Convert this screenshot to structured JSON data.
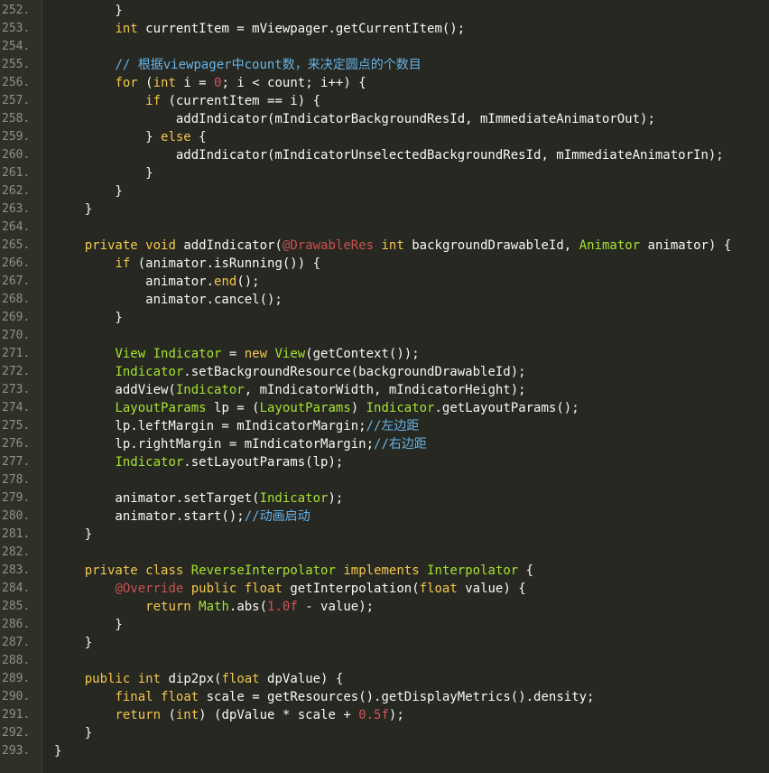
{
  "colors": {
    "background": "#272822",
    "gutter": "#2f3129",
    "plain": "#f8f8f2",
    "keyword": "#f3c74a",
    "type": "#a6e22e",
    "number": "#cf5555",
    "annotation": "#c7524f",
    "comment": "#66b3e6",
    "line_number": "#8f908a"
  },
  "lines": [
    {
      "n": "252.",
      "t": [
        [
          "plain",
          "        }"
        ]
      ]
    },
    {
      "n": "253.",
      "t": [
        [
          "plain",
          "        "
        ],
        [
          "kw",
          "int"
        ],
        [
          "plain",
          " currentItem = mViewpager.getCurrentItem();"
        ]
      ]
    },
    {
      "n": "254.",
      "t": []
    },
    {
      "n": "255.",
      "t": [
        [
          "plain",
          "        "
        ],
        [
          "cm",
          "// 根据viewpager中count数，来决定圆点的个数目"
        ]
      ]
    },
    {
      "n": "256.",
      "t": [
        [
          "plain",
          "        "
        ],
        [
          "kw",
          "for"
        ],
        [
          "plain",
          " ("
        ],
        [
          "kw",
          "int"
        ],
        [
          "plain",
          " i = "
        ],
        [
          "num",
          "0"
        ],
        [
          "plain",
          "; i < count; i++) {"
        ]
      ]
    },
    {
      "n": "257.",
      "t": [
        [
          "plain",
          "            "
        ],
        [
          "kw",
          "if"
        ],
        [
          "plain",
          " (currentItem == i) {"
        ]
      ]
    },
    {
      "n": "258.",
      "t": [
        [
          "plain",
          "                addIndicator(mIndicatorBackgroundResId, mImmediateAnimatorOut);"
        ]
      ]
    },
    {
      "n": "259.",
      "t": [
        [
          "plain",
          "            } "
        ],
        [
          "kw",
          "else"
        ],
        [
          "plain",
          " {"
        ]
      ]
    },
    {
      "n": "260.",
      "t": [
        [
          "plain",
          "                addIndicator(mIndicatorUnselectedBackgroundResId, mImmediateAnimatorIn);"
        ]
      ]
    },
    {
      "n": "261.",
      "t": [
        [
          "plain",
          "            }"
        ]
      ]
    },
    {
      "n": "262.",
      "t": [
        [
          "plain",
          "        }"
        ]
      ]
    },
    {
      "n": "263.",
      "t": [
        [
          "plain",
          "    }"
        ]
      ]
    },
    {
      "n": "264.",
      "t": []
    },
    {
      "n": "265.",
      "t": [
        [
          "plain",
          "    "
        ],
        [
          "kw",
          "private"
        ],
        [
          "plain",
          " "
        ],
        [
          "kw",
          "void"
        ],
        [
          "plain",
          " addIndicator("
        ],
        [
          "ann",
          "@DrawableRes"
        ],
        [
          "plain",
          " "
        ],
        [
          "kw",
          "int"
        ],
        [
          "plain",
          " backgroundDrawableId, "
        ],
        [
          "type",
          "Animator"
        ],
        [
          "plain",
          " animator) {"
        ]
      ]
    },
    {
      "n": "266.",
      "t": [
        [
          "plain",
          "        "
        ],
        [
          "kw",
          "if"
        ],
        [
          "plain",
          " (animator.isRunning()) {"
        ]
      ]
    },
    {
      "n": "267.",
      "t": [
        [
          "plain",
          "            animator."
        ],
        [
          "kw",
          "end"
        ],
        [
          "plain",
          "();"
        ]
      ]
    },
    {
      "n": "268.",
      "t": [
        [
          "plain",
          "            animator.cancel();"
        ]
      ]
    },
    {
      "n": "269.",
      "t": [
        [
          "plain",
          "        }"
        ]
      ]
    },
    {
      "n": "270.",
      "t": []
    },
    {
      "n": "271.",
      "t": [
        [
          "plain",
          "        "
        ],
        [
          "type",
          "View"
        ],
        [
          "plain",
          " "
        ],
        [
          "type",
          "Indicator"
        ],
        [
          "plain",
          " = "
        ],
        [
          "kw",
          "new"
        ],
        [
          "plain",
          " "
        ],
        [
          "type",
          "View"
        ],
        [
          "plain",
          "(getContext());"
        ]
      ]
    },
    {
      "n": "272.",
      "t": [
        [
          "plain",
          "        "
        ],
        [
          "type",
          "Indicator"
        ],
        [
          "plain",
          ".setBackgroundResource(backgroundDrawableId);"
        ]
      ]
    },
    {
      "n": "273.",
      "t": [
        [
          "plain",
          "        addView("
        ],
        [
          "type",
          "Indicator"
        ],
        [
          "plain",
          ", mIndicatorWidth, mIndicatorHeight);"
        ]
      ]
    },
    {
      "n": "274.",
      "t": [
        [
          "plain",
          "        "
        ],
        [
          "type",
          "LayoutParams"
        ],
        [
          "plain",
          " lp = ("
        ],
        [
          "type",
          "LayoutParams"
        ],
        [
          "plain",
          ") "
        ],
        [
          "type",
          "Indicator"
        ],
        [
          "plain",
          ".getLayoutParams();"
        ]
      ]
    },
    {
      "n": "275.",
      "t": [
        [
          "plain",
          "        lp.leftMargin = mIndicatorMargin;"
        ],
        [
          "cm",
          "//左边距"
        ]
      ]
    },
    {
      "n": "276.",
      "t": [
        [
          "plain",
          "        lp.rightMargin = mIndicatorMargin;"
        ],
        [
          "cm",
          "//右边距"
        ]
      ]
    },
    {
      "n": "277.",
      "t": [
        [
          "plain",
          "        "
        ],
        [
          "type",
          "Indicator"
        ],
        [
          "plain",
          ".setLayoutParams(lp);"
        ]
      ]
    },
    {
      "n": "278.",
      "t": []
    },
    {
      "n": "279.",
      "t": [
        [
          "plain",
          "        animator.setTarget("
        ],
        [
          "type",
          "Indicator"
        ],
        [
          "plain",
          ");"
        ]
      ]
    },
    {
      "n": "280.",
      "t": [
        [
          "plain",
          "        animator.start();"
        ],
        [
          "cm",
          "//动画启动"
        ]
      ]
    },
    {
      "n": "281.",
      "t": [
        [
          "plain",
          "    }"
        ]
      ]
    },
    {
      "n": "282.",
      "t": []
    },
    {
      "n": "283.",
      "t": [
        [
          "plain",
          "    "
        ],
        [
          "kw",
          "private"
        ],
        [
          "plain",
          " "
        ],
        [
          "kw",
          "class"
        ],
        [
          "plain",
          " "
        ],
        [
          "type",
          "ReverseInterpolator"
        ],
        [
          "plain",
          " "
        ],
        [
          "kw",
          "implements"
        ],
        [
          "plain",
          " "
        ],
        [
          "type",
          "Interpolator"
        ],
        [
          "plain",
          " {"
        ]
      ]
    },
    {
      "n": "284.",
      "t": [
        [
          "plain",
          "        "
        ],
        [
          "ann",
          "@Override"
        ],
        [
          "plain",
          " "
        ],
        [
          "kw",
          "public"
        ],
        [
          "plain",
          " "
        ],
        [
          "kw",
          "float"
        ],
        [
          "plain",
          " getInterpolation("
        ],
        [
          "kw",
          "float"
        ],
        [
          "plain",
          " value) {"
        ]
      ]
    },
    {
      "n": "285.",
      "t": [
        [
          "plain",
          "            "
        ],
        [
          "kw",
          "return"
        ],
        [
          "plain",
          " "
        ],
        [
          "type",
          "Math"
        ],
        [
          "plain",
          ".abs("
        ],
        [
          "num",
          "1.0f"
        ],
        [
          "plain",
          " - value);"
        ]
      ]
    },
    {
      "n": "286.",
      "t": [
        [
          "plain",
          "        }"
        ]
      ]
    },
    {
      "n": "287.",
      "t": [
        [
          "plain",
          "    }"
        ]
      ]
    },
    {
      "n": "288.",
      "t": []
    },
    {
      "n": "289.",
      "t": [
        [
          "plain",
          "    "
        ],
        [
          "kw",
          "public"
        ],
        [
          "plain",
          " "
        ],
        [
          "kw",
          "int"
        ],
        [
          "plain",
          " dip2px("
        ],
        [
          "kw",
          "float"
        ],
        [
          "plain",
          " dpValue) {"
        ]
      ]
    },
    {
      "n": "290.",
      "t": [
        [
          "plain",
          "        "
        ],
        [
          "kw",
          "final"
        ],
        [
          "plain",
          " "
        ],
        [
          "kw",
          "float"
        ],
        [
          "plain",
          " scale = getResources().getDisplayMetrics().density;"
        ]
      ]
    },
    {
      "n": "291.",
      "t": [
        [
          "plain",
          "        "
        ],
        [
          "kw",
          "return"
        ],
        [
          "plain",
          " ("
        ],
        [
          "kw",
          "int"
        ],
        [
          "plain",
          ") (dpValue * scale + "
        ],
        [
          "num",
          "0.5f"
        ],
        [
          "plain",
          ");"
        ]
      ]
    },
    {
      "n": "292.",
      "t": [
        [
          "plain",
          "    }"
        ]
      ]
    },
    {
      "n": "293.",
      "t": [
        [
          "plain",
          "}"
        ]
      ]
    }
  ]
}
